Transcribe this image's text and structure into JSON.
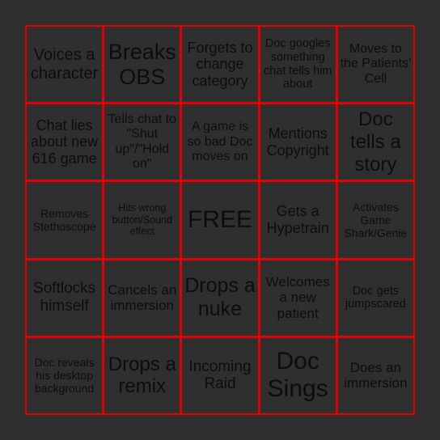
{
  "board": {
    "accent_color": "#e60000",
    "background_color": "#2f2f2f",
    "cells": [
      "Voices a character",
      "Breaks OBS",
      "Forgets to change category",
      "Doc googles something chat tells him about",
      "Moves to the Patients' Cell",
      "Chat lies about new 616 game",
      "Tells chat to \"Shut up\"/\"Hold on\"",
      "A game is so bad Doc moves on",
      "Mentions Copyright",
      "Doc tells a story",
      "Removes Stethoscope",
      "Hits wrong button/Sound effect",
      "FREE",
      "Gets a Hypetrain",
      "Activates Game Shark/Genie",
      "Softlocks himself",
      "Cancels an immersion",
      "Drops a nuke",
      "Welcomes a new patient",
      "Doc gets jumpscared",
      "Doc reveals his desktop background",
      "Drops a remix",
      "Incoming Raid",
      "Doc Sings",
      "Does an immersion"
    ]
  }
}
